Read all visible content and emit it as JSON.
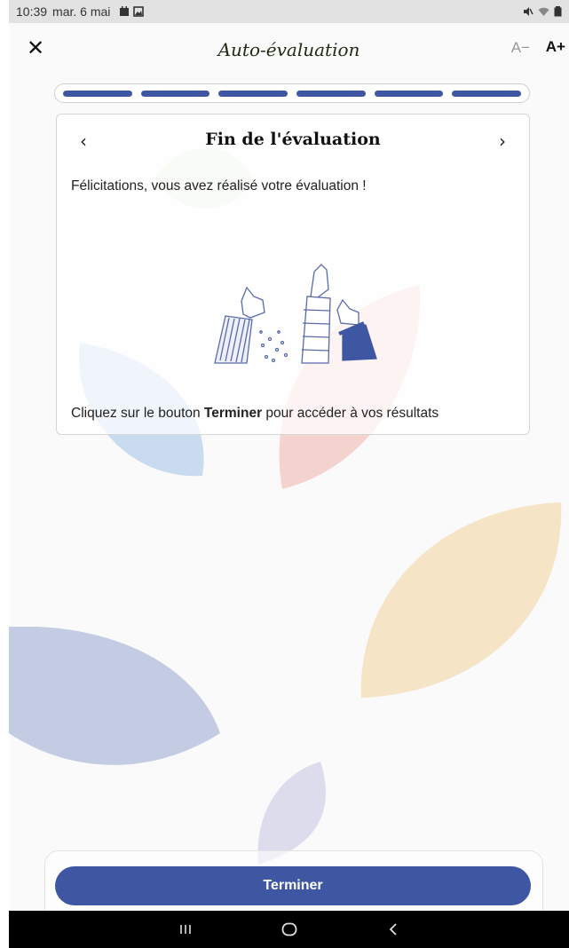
{
  "status": {
    "time": "10:39",
    "date": "mar. 6 mai"
  },
  "header": {
    "close_icon": "close-icon",
    "title": "Auto-évaluation",
    "font_decrease": "A−",
    "font_increase": "A+"
  },
  "progress": {
    "steps_total": 6,
    "steps_completed": 6
  },
  "card": {
    "title": "Fin de l'évaluation",
    "prev_icon": "chevron-left-icon",
    "next_icon": "chevron-right-icon",
    "message": "Félicitations, vous avez réalisé votre évaluation !",
    "footer_prefix": "Cliquez sur le bouton ",
    "footer_bold": "Terminer",
    "footer_suffix": " pour accéder à vos résultats"
  },
  "actions": {
    "finish_label": "Terminer"
  },
  "colors": {
    "accent": "#3f56a3",
    "leaf_blue": "#c4cce3",
    "leaf_orange": "#f5e4c6",
    "leaf_pink": "#f4d3cf",
    "leaf_lavender": "#dcdcec",
    "leaf_light_blue": "#c9dbef",
    "leaf_green": "#e4eedc"
  }
}
